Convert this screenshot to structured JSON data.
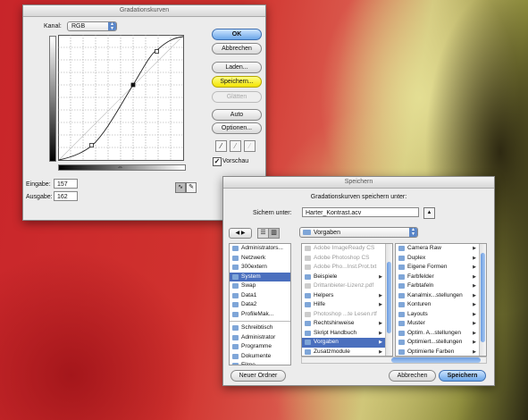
{
  "curves": {
    "title": "Gradationskurven",
    "kanal_label": "Kanal:",
    "kanal_value": "RGB",
    "eingabe_label": "Eingabe:",
    "eingabe_value": "157",
    "ausgabe_label": "Ausgabe:",
    "ausgabe_value": "162",
    "buttons": {
      "ok": "OK",
      "abbrechen": "Abbrechen",
      "laden": "Laden...",
      "speichern": "Speichern...",
      "glaetten": "Glätten",
      "auto": "Auto",
      "optionen": "Optionen..."
    },
    "vorschau_label": "Vorschau",
    "vorschau_checked": true
  },
  "save_dialog": {
    "title": "Speichern",
    "prompt": "Gradationskurven speichern unter:",
    "sichern_label": "Sichern unter:",
    "filename": "Harter_Kontrast.acv",
    "location": "Vorgaben",
    "col1_items": [
      {
        "label": "Administrators...",
        "icon": "hard-disk-icon",
        "state": ""
      },
      {
        "label": "Netzwerk",
        "icon": "network-icon",
        "state": ""
      },
      {
        "label": "300extern",
        "icon": "hard-disk-icon",
        "state": ""
      },
      {
        "label": "System",
        "icon": "hard-disk-icon",
        "state": "sel"
      },
      {
        "label": "Swap",
        "icon": "hard-disk-icon",
        "state": ""
      },
      {
        "label": "Data1",
        "icon": "hard-disk-icon",
        "state": ""
      },
      {
        "label": "Data2",
        "icon": "hard-disk-icon",
        "state": ""
      },
      {
        "label": "ProfileMak...",
        "icon": "disk-icon",
        "state": ""
      }
    ],
    "col1_places": [
      {
        "label": "Schreibtisch",
        "icon": "desktop-icon"
      },
      {
        "label": "Administrator",
        "icon": "home-icon"
      },
      {
        "label": "Programme",
        "icon": "applications-icon"
      },
      {
        "label": "Dokumente",
        "icon": "documents-icon"
      },
      {
        "label": "Filme",
        "icon": "movies-icon"
      }
    ],
    "col2_items": [
      {
        "label": "Adobe ImageReady CS",
        "state": "dim",
        "arrow": false
      },
      {
        "label": "Adobe Photoshop CS",
        "state": "dim",
        "arrow": false
      },
      {
        "label": "Adobe Pho...Inst.Prot.txt",
        "state": "dim",
        "arrow": false
      },
      {
        "label": "Beispiele",
        "state": "",
        "arrow": true
      },
      {
        "label": "Drittanbieter-Lizenz.pdf",
        "state": "dim",
        "arrow": false
      },
      {
        "label": "Helpers",
        "state": "",
        "arrow": true
      },
      {
        "label": "Hilfe",
        "state": "",
        "arrow": true
      },
      {
        "label": "Photoshop ...te Lesen.rtf",
        "state": "dim",
        "arrow": false
      },
      {
        "label": "Rechtshinweise",
        "state": "",
        "arrow": true
      },
      {
        "label": "Skript Handbuch",
        "state": "",
        "arrow": true
      },
      {
        "label": "Vorgaben",
        "state": "sel",
        "arrow": true
      },
      {
        "label": "Zusatzmodule",
        "state": "",
        "arrow": true
      }
    ],
    "col3_items": [
      {
        "label": "Camera Raw"
      },
      {
        "label": "Duplex"
      },
      {
        "label": "Eigene Formen"
      },
      {
        "label": "Farbfelder"
      },
      {
        "label": "Farbtafeln"
      },
      {
        "label": "Kanalmix...stellungen"
      },
      {
        "label": "Konturen"
      },
      {
        "label": "Layouts"
      },
      {
        "label": "Muster"
      },
      {
        "label": "Optim. A...stellungen"
      },
      {
        "label": "Optimiert...stellungen"
      },
      {
        "label": "Optimierte Farben"
      }
    ],
    "neuer_ordner": "Neuer Ordner",
    "abbrechen": "Abbrechen",
    "speichern": "Speichern"
  }
}
